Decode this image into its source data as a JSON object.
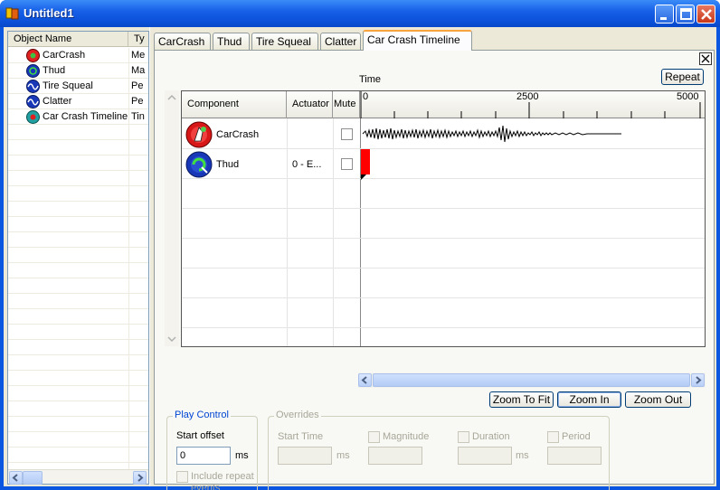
{
  "window": {
    "title": "Untitled1"
  },
  "object_list": {
    "headers": {
      "name": "Object Name",
      "type": "Ty"
    },
    "items": [
      {
        "name": "CarCrash",
        "type": "Me",
        "icon": "carcrash-icon"
      },
      {
        "name": "Thud",
        "type": "Ma",
        "icon": "thud-icon"
      },
      {
        "name": "Tire Squeal",
        "type": "Pe",
        "icon": "periodic-icon"
      },
      {
        "name": "Clatter",
        "type": "Pe",
        "icon": "periodic-icon"
      },
      {
        "name": "Car Crash Timeline",
        "type": "Tin",
        "icon": "timeline-icon"
      }
    ]
  },
  "tabs": [
    {
      "label": "CarCrash"
    },
    {
      "label": "Thud"
    },
    {
      "label": "Tire Squeal"
    },
    {
      "label": "Clatter"
    },
    {
      "label": "Car Crash Timeline",
      "active": true
    }
  ],
  "timeline": {
    "repeat_label": "Repeat",
    "time_label": "Time",
    "headers": {
      "component": "Component",
      "actuator": "Actuator",
      "mute": "Mute"
    },
    "ruler": {
      "start": "0",
      "mid": "2500",
      "end": "5000"
    },
    "rows": [
      {
        "component": "CarCrash",
        "actuator": "",
        "mute": false,
        "icon": "carcrash-icon"
      },
      {
        "component": "Thud",
        "actuator": "0 - E...",
        "mute": false,
        "icon": "thud-icon"
      }
    ],
    "zoom_to_fit": "Zoom To Fit",
    "zoom_in": "Zoom In",
    "zoom_out": "Zoom Out"
  },
  "play_control": {
    "title": "Play Control",
    "start_offset_label": "Start offset",
    "start_offset_value": "0",
    "unit": "ms",
    "include_repeat_line1": "Include repeat",
    "include_repeat_line2": "events"
  },
  "overrides": {
    "title": "Overrides",
    "start_time": "Start Time",
    "magnitude": "Magnitude",
    "duration": "Duration",
    "period": "Period",
    "unit": "ms"
  },
  "colors": {
    "accent": "#0a56e0",
    "thud_bar": "#ff0000",
    "tab_highlight": "#f7a33f"
  }
}
